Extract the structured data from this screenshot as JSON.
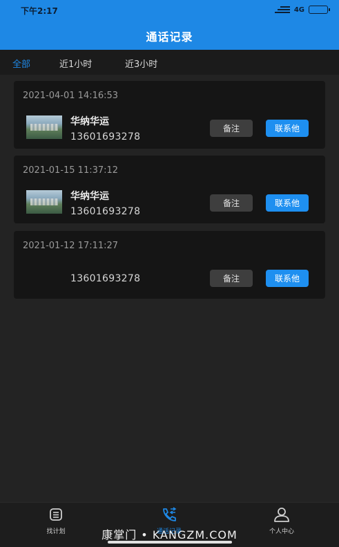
{
  "status_bar": {
    "time": "下午2:17",
    "network": "4G"
  },
  "header": {
    "title": "通话记录"
  },
  "tabs": [
    {
      "label": "全部",
      "active": true
    },
    {
      "label": "近1小时",
      "active": false
    },
    {
      "label": "近3小时",
      "active": false
    }
  ],
  "records": [
    {
      "time": "2021-04-01 14:16:53",
      "name": "华纳华运",
      "phone": "13601693278",
      "note_label": "备注",
      "contact_label": "联系他"
    },
    {
      "time": "2021-01-15 11:37:12",
      "name": "华纳华运",
      "phone": "13601693278",
      "note_label": "备注",
      "contact_label": "联系他"
    },
    {
      "time": "2021-01-12 17:11:27",
      "name": "",
      "phone": "13601693278",
      "note_label": "备注",
      "contact_label": "联系他"
    }
  ],
  "bottom_nav": [
    {
      "label": "找计划",
      "icon": "plan-icon",
      "active": false
    },
    {
      "label": "通话记录",
      "icon": "phone-icon",
      "active": true
    },
    {
      "label": "个人中心",
      "icon": "user-icon",
      "active": false
    }
  ],
  "watermark": "康掌门 • KANGZM.COM",
  "colors": {
    "accent": "#1e88e5",
    "background": "#232323",
    "card": "#151515"
  }
}
